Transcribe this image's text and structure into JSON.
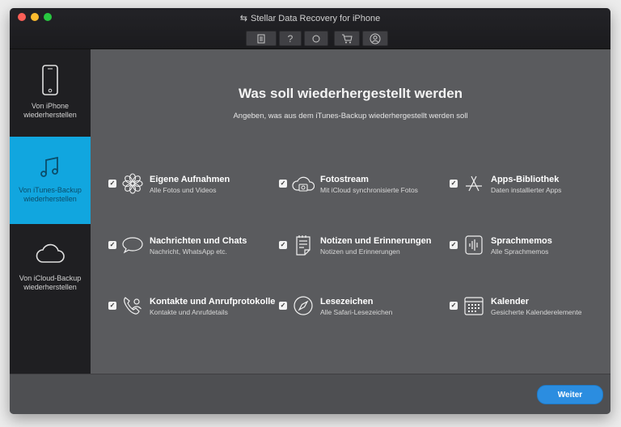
{
  "window": {
    "title": "Stellar Data Recovery for iPhone"
  },
  "toolbar": {
    "buttons": [
      {
        "name": "log-icon",
        "glyph": "▤"
      },
      {
        "name": "help-icon",
        "glyph": "?"
      },
      {
        "name": "refresh-icon",
        "glyph": "⟳"
      },
      {
        "name": "cart-icon",
        "glyph": "🛒"
      },
      {
        "name": "account-icon",
        "glyph": "◎"
      }
    ]
  },
  "sidebar": {
    "items": [
      {
        "label": "Von iPhone wiederherstellen",
        "icon": "iphone-icon",
        "active": false
      },
      {
        "label": "Von iTunes-Backup wiederherstellen",
        "icon": "music-note-icon",
        "active": true
      },
      {
        "label": "Von iCloud-Backup wiederherstellen",
        "icon": "cloud-icon",
        "active": false
      }
    ]
  },
  "main": {
    "heading": "Was soll wiederhergestellt werden",
    "subheading": "Angeben, was aus dem iTunes-Backup wiederhergestellt werden soll",
    "options": [
      {
        "title": "Eigene Aufnahmen",
        "desc": "Alle Fotos und Videos",
        "icon": "photos-icon",
        "checked": true
      },
      {
        "title": "Fotostream",
        "desc": "Mit iCloud synchronisierte Fotos",
        "icon": "photostream-icon",
        "checked": true
      },
      {
        "title": "Apps-Bibliothek",
        "desc": "Daten installierter Apps",
        "icon": "app-library-icon",
        "checked": true
      },
      {
        "title": "Nachrichten und Chats",
        "desc": "Nachricht, WhatsApp etc.",
        "icon": "chat-bubble-icon",
        "checked": true
      },
      {
        "title": "Notizen und Erinnerungen",
        "desc": "Notizen und Erinnerungen",
        "icon": "notes-icon",
        "checked": true
      },
      {
        "title": "Sprachmemos",
        "desc": "Alle Sprachmemos",
        "icon": "voice-memo-icon",
        "checked": true
      },
      {
        "title": "Kontakte und Anrufprotokolle",
        "desc": "Kontakte und Anrufdetails",
        "icon": "contacts-icon",
        "checked": true
      },
      {
        "title": "Lesezeichen",
        "desc": "Alle Safari-Lesezeichen",
        "icon": "safari-compass-icon",
        "checked": true
      },
      {
        "title": "Kalender",
        "desc": "Gesicherte Kalenderelemente",
        "icon": "calendar-icon",
        "checked": true
      }
    ]
  },
  "footer": {
    "next_label": "Weiter"
  },
  "colors": {
    "accent": "#11a6df",
    "button": "#2b8de0",
    "content_bg": "#5a5b5e",
    "sidebar_bg": "#1f1f22"
  }
}
